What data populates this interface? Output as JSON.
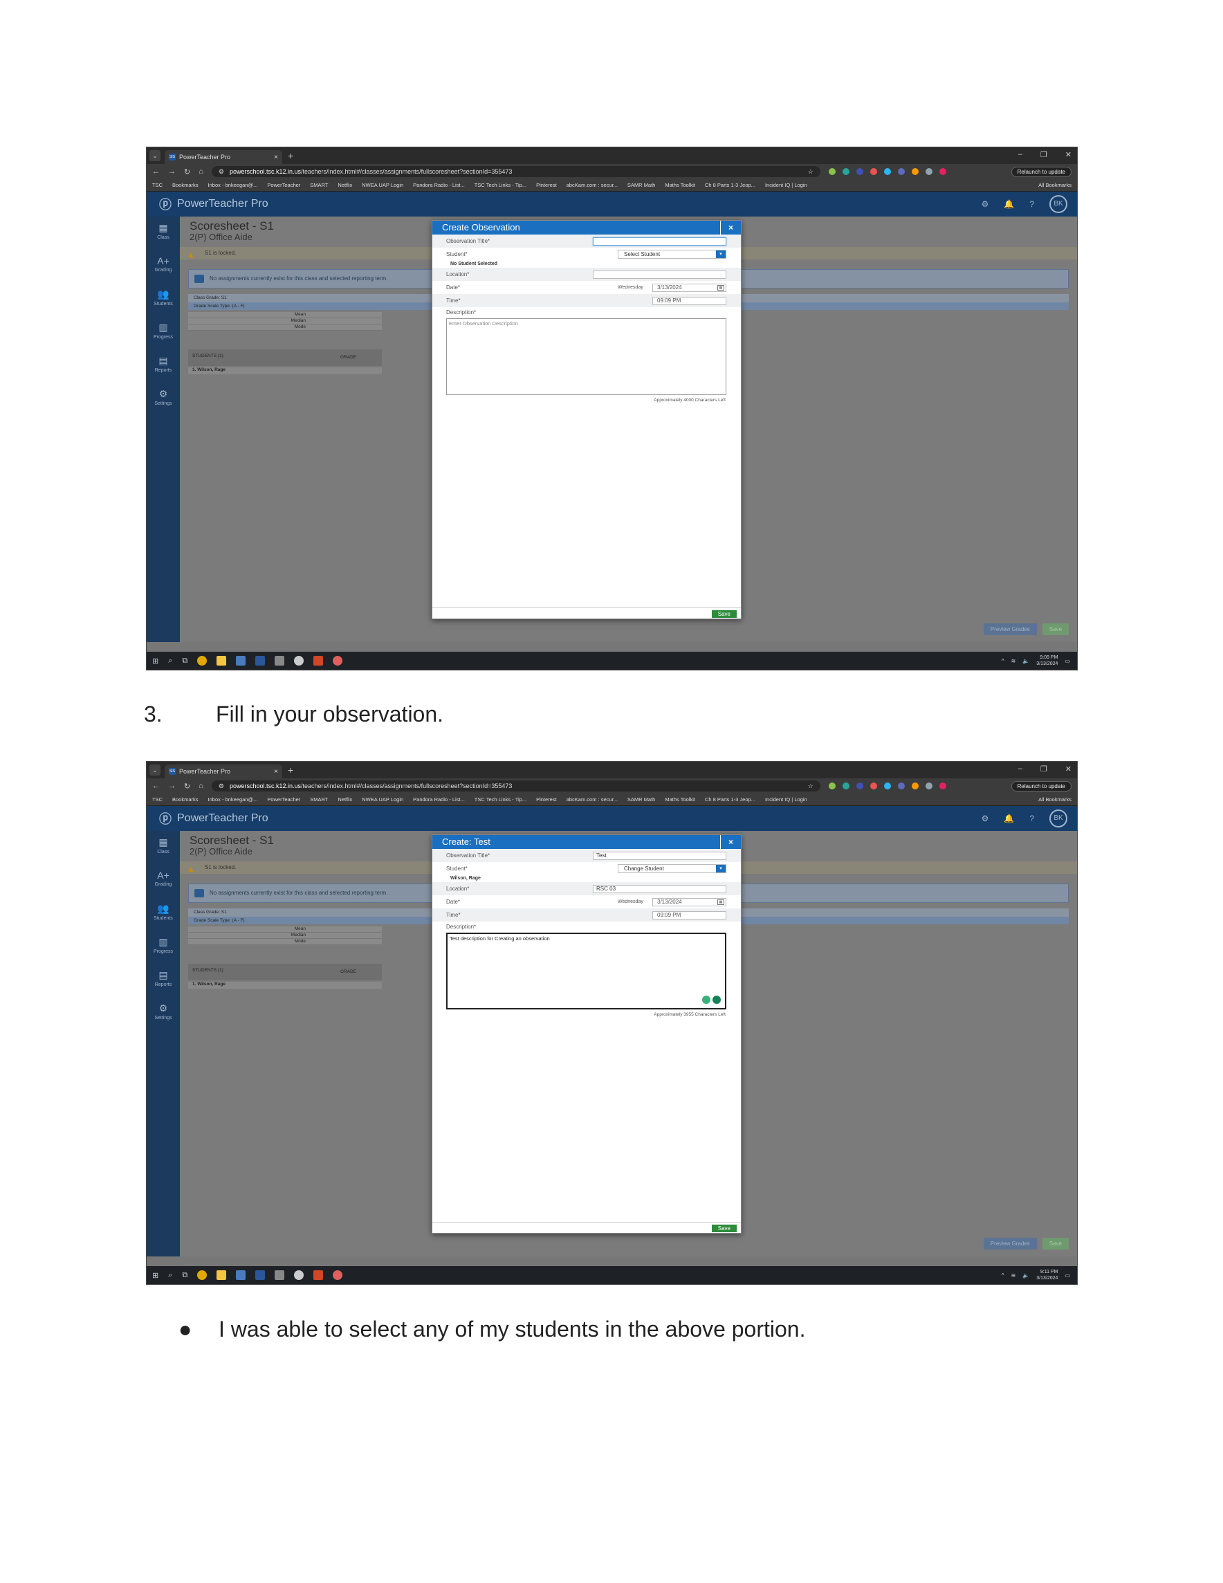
{
  "browser": {
    "tab_title": "PowerTeacher Pro",
    "tab_favicon": "SIS",
    "url_host": "powerschool.tsc.k12.in.us",
    "url_path": "/teachers/index.html#/classes/assignments/fullscoresheet?sectionId=355473",
    "relaunch": "Relaunch to update",
    "bookmarks": [
      "TSC",
      "Bookmarks",
      "Inbox - bnkeegan@...",
      "PowerTeacher",
      "SMART",
      "Netflix",
      "NWEA UAP Login",
      "Pandora Radio - List...",
      "TSC Tech Links - Tip...",
      "Pinterest",
      "abcKam.com : secur...",
      "SAMR Math",
      "Maths Toolkit",
      "Ch 8 Parts 1-3 Jeop...",
      "Incident IQ | Login"
    ],
    "all_bookmarks": "All Bookmarks"
  },
  "app": {
    "title": "PowerTeacher Pro",
    "avatar": "BK",
    "term": "S1",
    "sidebar": [
      "Class",
      "Grading",
      "Students",
      "Progress",
      "Reports",
      "Settings"
    ],
    "sheet_title": "Scoresheet - S1",
    "sheet_sub": "2(P) Office Aide",
    "locked": "S1 is locked.",
    "notice": "No assignments currently exist for this class and selected reporting term.",
    "class_grade": "Class Grade: S1",
    "grade_scale": "Grade Scale Type: (A - F)",
    "stats": [
      "Mean",
      "Median",
      "Mode"
    ],
    "students_hdr": "STUDENTS (1)",
    "grade_hdr": "GRADE",
    "student_row": "1. Wilson, Rage",
    "preview": "Preview Grades",
    "save": "Save"
  },
  "taskbar1": {
    "time": "9:09 PM",
    "date": "3/13/2024"
  },
  "taskbar2": {
    "time": "9:11 PM",
    "date": "3/13/2024"
  },
  "modal1": {
    "title": "Create Observation",
    "obs_label": "Observation Title*",
    "obs_value": "",
    "student_label": "Student*",
    "student_select": "Select Student",
    "student_selected": "No Student Selected",
    "location_label": "Location*",
    "location_value": "",
    "date_label": "Date*",
    "weekday": "Wednesday",
    "date": "3/13/2024",
    "time_label": "Time*",
    "time": "09:09 PM",
    "desc_label": "Description*",
    "desc": "Enter Observation Description",
    "chars": "Approximately 4000 Characters Left",
    "save": "Save"
  },
  "modal2": {
    "title": "Create: Test",
    "obs_label": "Observation Title*",
    "obs_value": "Test",
    "student_label": "Student*",
    "student_select": "Change Student",
    "student_selected": "Wilson, Rage",
    "location_label": "Location*",
    "location_value": "RSC 03",
    "date_label": "Date*",
    "weekday": "Wednesday",
    "date": "3/13/2024",
    "time_label": "Time*",
    "time": "09:09 PM",
    "desc_label": "Description*",
    "desc": "Test description for Creating an observation",
    "chars": "Approximately 3955 Characters Left",
    "save": "Save"
  },
  "doc": {
    "step_num": "3.",
    "step_text": "Fill in your observation.",
    "bullet": "●",
    "bullet_text": "I was able to select any of my students in the above portion."
  }
}
